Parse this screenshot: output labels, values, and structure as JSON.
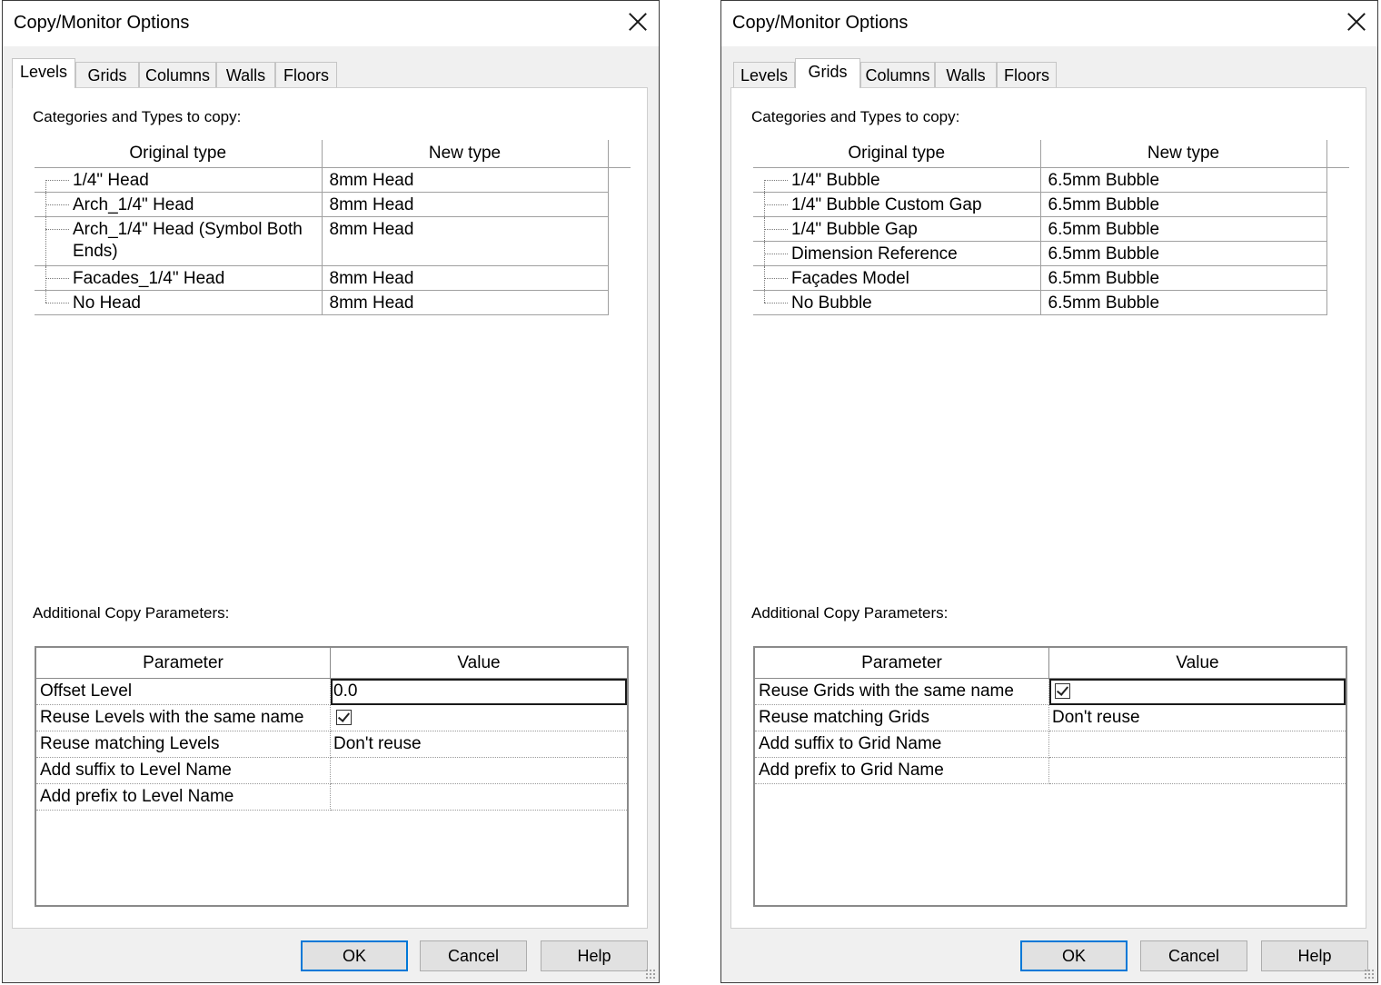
{
  "dialogs": [
    {
      "title": "Copy/Monitor Options",
      "tabs": [
        "Levels",
        "Grids",
        "Columns",
        "Walls",
        "Floors"
      ],
      "active_tab": "Levels",
      "categories_label": "Categories and Types to copy:",
      "types_headers": {
        "original": "Original type",
        "new": "New type"
      },
      "types": [
        {
          "original": "1/4\" Head",
          "new": "8mm Head"
        },
        {
          "original": "Arch_1/4\" Head",
          "new": "8mm Head"
        },
        {
          "original": "Arch_1/4\" Head (Symbol Both Ends)",
          "new": "8mm Head"
        },
        {
          "original": "Facades_1/4\" Head",
          "new": "8mm Head"
        },
        {
          "original": "No Head",
          "new": "8mm Head"
        }
      ],
      "params_label": "Additional Copy Parameters:",
      "params_headers": {
        "parameter": "Parameter",
        "value": "Value"
      },
      "params": [
        {
          "parameter": "Offset Level",
          "value": "0.0",
          "checkbox": false,
          "selected": true
        },
        {
          "parameter": "Reuse Levels with the same name",
          "value": "",
          "checkbox": true,
          "selected": false
        },
        {
          "parameter": "Reuse matching Levels",
          "value": "Don't reuse",
          "checkbox": false,
          "selected": false
        },
        {
          "parameter": "Add suffix to Level Name",
          "value": "",
          "checkbox": false,
          "selected": false
        },
        {
          "parameter": "Add prefix to Level Name",
          "value": "",
          "checkbox": false,
          "selected": false
        }
      ],
      "buttons": {
        "ok": "OK",
        "cancel": "Cancel",
        "help": "Help"
      }
    },
    {
      "title": "Copy/Monitor Options",
      "tabs": [
        "Levels",
        "Grids",
        "Columns",
        "Walls",
        "Floors"
      ],
      "active_tab": "Grids",
      "categories_label": "Categories and Types to copy:",
      "types_headers": {
        "original": "Original type",
        "new": "New type"
      },
      "types": [
        {
          "original": "1/4\" Bubble",
          "new": "6.5mm Bubble"
        },
        {
          "original": "1/4\" Bubble Custom Gap",
          "new": "6.5mm Bubble"
        },
        {
          "original": "1/4\" Bubble Gap",
          "new": "6.5mm Bubble"
        },
        {
          "original": "Dimension Reference",
          "new": "6.5mm Bubble"
        },
        {
          "original": "Façades Model",
          "new": "6.5mm Bubble"
        },
        {
          "original": "No Bubble",
          "new": "6.5mm Bubble"
        }
      ],
      "params_label": "Additional Copy Parameters:",
      "params_headers": {
        "parameter": "Parameter",
        "value": "Value"
      },
      "params": [
        {
          "parameter": "Reuse Grids with the same name",
          "value": "",
          "checkbox": true,
          "selected": true
        },
        {
          "parameter": "Reuse matching Grids",
          "value": "Don't reuse",
          "checkbox": false,
          "selected": false
        },
        {
          "parameter": "Add suffix to Grid Name",
          "value": "",
          "checkbox": false,
          "selected": false
        },
        {
          "parameter": "Add prefix to Grid Name",
          "value": "",
          "checkbox": false,
          "selected": false
        }
      ],
      "buttons": {
        "ok": "OK",
        "cancel": "Cancel",
        "help": "Help"
      }
    }
  ]
}
